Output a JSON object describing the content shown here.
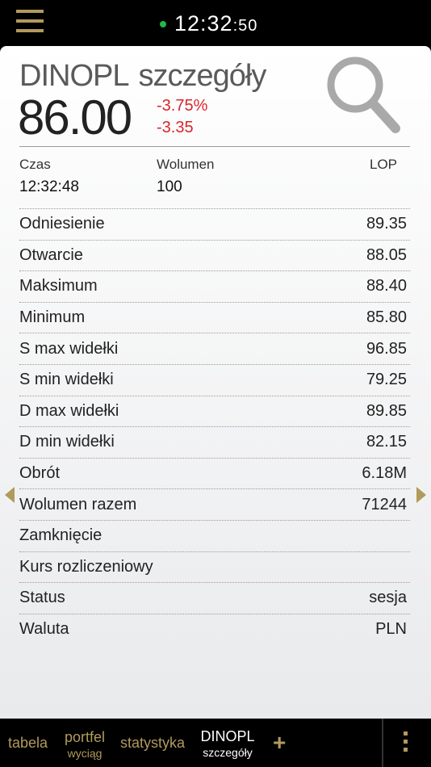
{
  "clock": {
    "main": "12:32",
    "seconds": ":50"
  },
  "header": {
    "symbol": "DINOPL",
    "subtitle": "szczegóły",
    "price": "86.00",
    "change_pct": "-3.75%",
    "change_abs": "-3.35"
  },
  "columns": [
    {
      "label": "Czas",
      "value": "12:32:48"
    },
    {
      "label": "Wolumen",
      "value": "100"
    },
    {
      "label": "LOP",
      "value": ""
    }
  ],
  "rows": [
    {
      "label": "Odniesienie",
      "value": "89.35"
    },
    {
      "label": "Otwarcie",
      "value": "88.05"
    },
    {
      "label": "Maksimum",
      "value": "88.40"
    },
    {
      "label": "Minimum",
      "value": "85.80"
    },
    {
      "label": "S max widełki",
      "value": "96.85"
    },
    {
      "label": "S min widełki",
      "value": "79.25"
    },
    {
      "label": "D max widełki",
      "value": "89.85"
    },
    {
      "label": "D min widełki",
      "value": "82.15"
    },
    {
      "label": "Obrót",
      "value": "6.18M"
    },
    {
      "label": "Wolumen razem",
      "value": "71244"
    },
    {
      "label": "Zamknięcie",
      "value": ""
    },
    {
      "label": "Kurs rozliczeniowy",
      "value": ""
    },
    {
      "label": "Status",
      "value": "sesja"
    },
    {
      "label": "Waluta",
      "value": "PLN"
    }
  ],
  "bottom_nav": {
    "tabela": "tabela",
    "portfel": "portfel",
    "portfel_sub": "wyciąg",
    "statystyka": "statystyka",
    "active": "DINOPL",
    "active_sub": "szczegóły",
    "plus": "+"
  },
  "colors": {
    "accent": "#b29a5c",
    "negative": "#d9262c",
    "status_dot": "#1fb84a"
  },
  "icons": [
    "menu-icon",
    "search-icon",
    "chevron-left-icon",
    "chevron-right-icon",
    "plus-icon",
    "more-vertical-icon"
  ]
}
